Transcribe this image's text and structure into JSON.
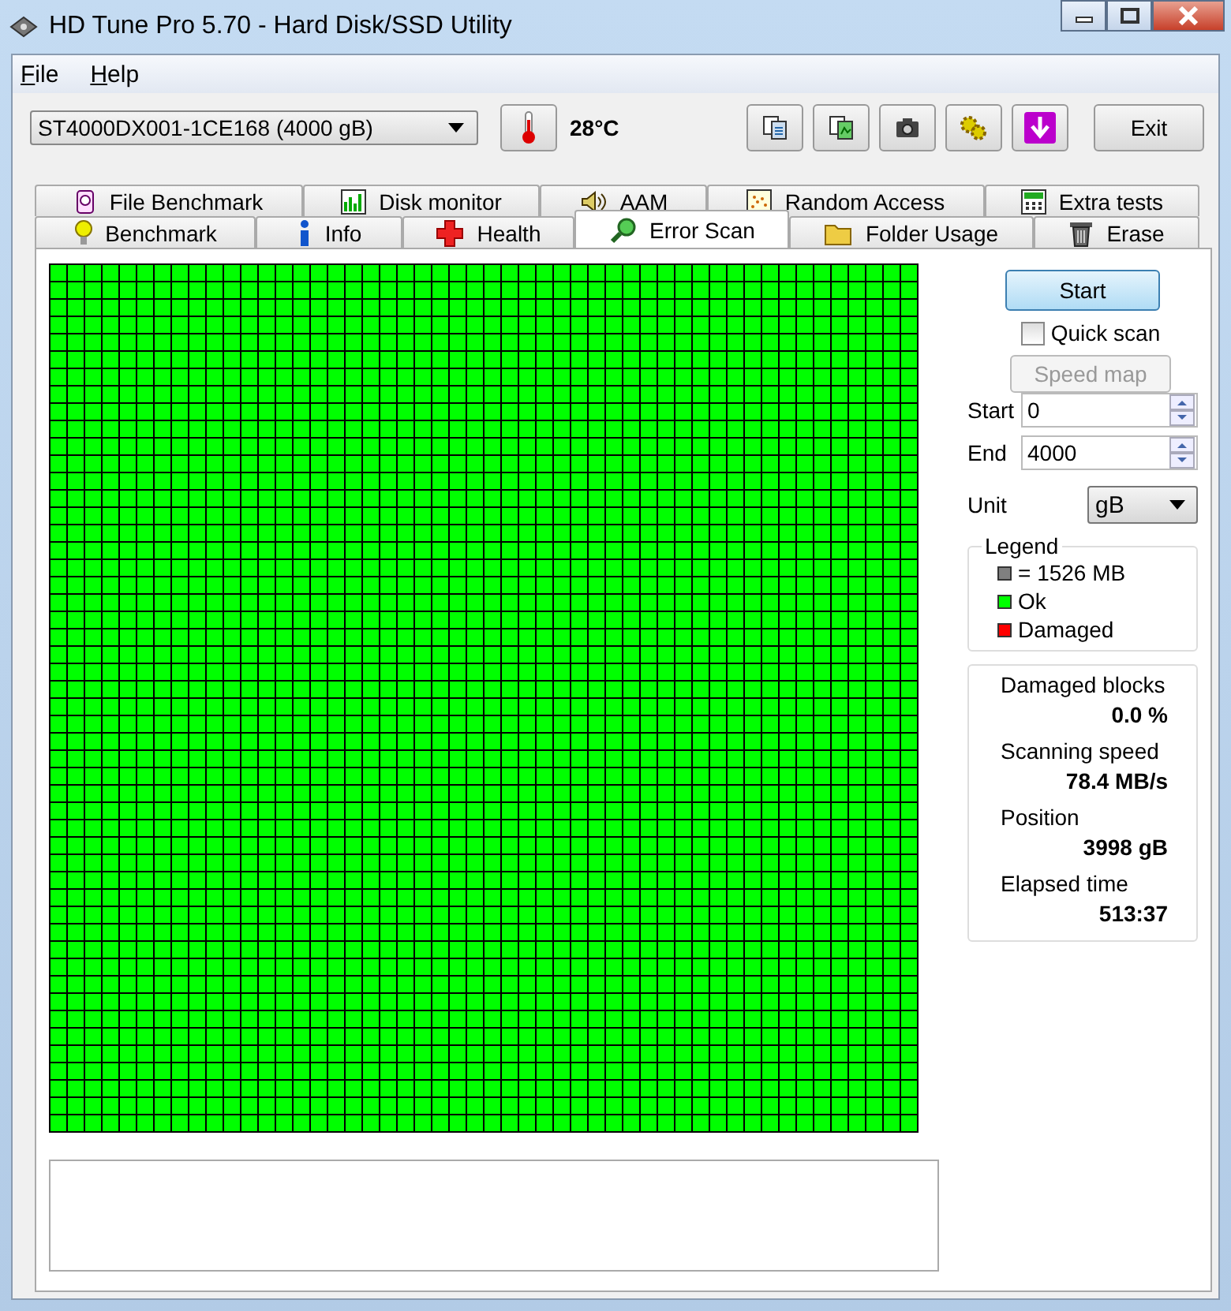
{
  "window": {
    "title": "HD Tune Pro 5.70 - Hard Disk/SSD Utility"
  },
  "menu": [
    {
      "label": "File"
    },
    {
      "label": "Help"
    }
  ],
  "drive_select": {
    "value": "ST4000DX001-1CE168 (4000 gB)"
  },
  "temperature": "28°C",
  "toolbar": [
    {
      "kind": "copy"
    },
    {
      "kind": "copy-image"
    },
    {
      "kind": "camera"
    },
    {
      "kind": "gears"
    },
    {
      "kind": "download"
    }
  ],
  "exit_button": "Exit",
  "tab_rows": [
    [
      {
        "label": "File Benchmark",
        "selected": false
      },
      {
        "label": "Disk monitor",
        "selected": false
      },
      {
        "label": "AAM",
        "selected": false
      },
      {
        "label": "Random Access",
        "selected": false
      },
      {
        "label": "Extra tests",
        "selected": false
      }
    ],
    [
      {
        "label": "Benchmark",
        "selected": false
      },
      {
        "label": "Info",
        "selected": false
      },
      {
        "label": "Health",
        "selected": false
      },
      {
        "label": "Error Scan",
        "selected": true
      },
      {
        "label": "Folder Usage",
        "selected": false
      },
      {
        "label": "Erase",
        "selected": false
      }
    ]
  ],
  "start_button": "Start",
  "quick_scan": {
    "label": "Quick scan",
    "checked": false
  },
  "speed_map_button": {
    "label": "Speed map",
    "disabled": true
  },
  "range": [
    {
      "label": "Start",
      "value": "0"
    },
    {
      "label": "End",
      "value": "4000"
    }
  ],
  "unit": {
    "label": "Unit",
    "value": "gB"
  },
  "legend": {
    "title": "Legend",
    "items": [
      {
        "label": "= 1526 MB",
        "color": "#808080"
      },
      {
        "label": "Ok",
        "color": "#00ff00"
      },
      {
        "label": "Damaged",
        "color": "#ff0000"
      }
    ]
  },
  "stats": [
    {
      "label": "Damaged blocks",
      "value": "0.0 %"
    },
    {
      "label": "Scanning speed",
      "value": "78.4 MB/s"
    },
    {
      "label": "Position",
      "value": "3998 gB"
    },
    {
      "label": "Elapsed time",
      "value": "513:37"
    }
  ]
}
